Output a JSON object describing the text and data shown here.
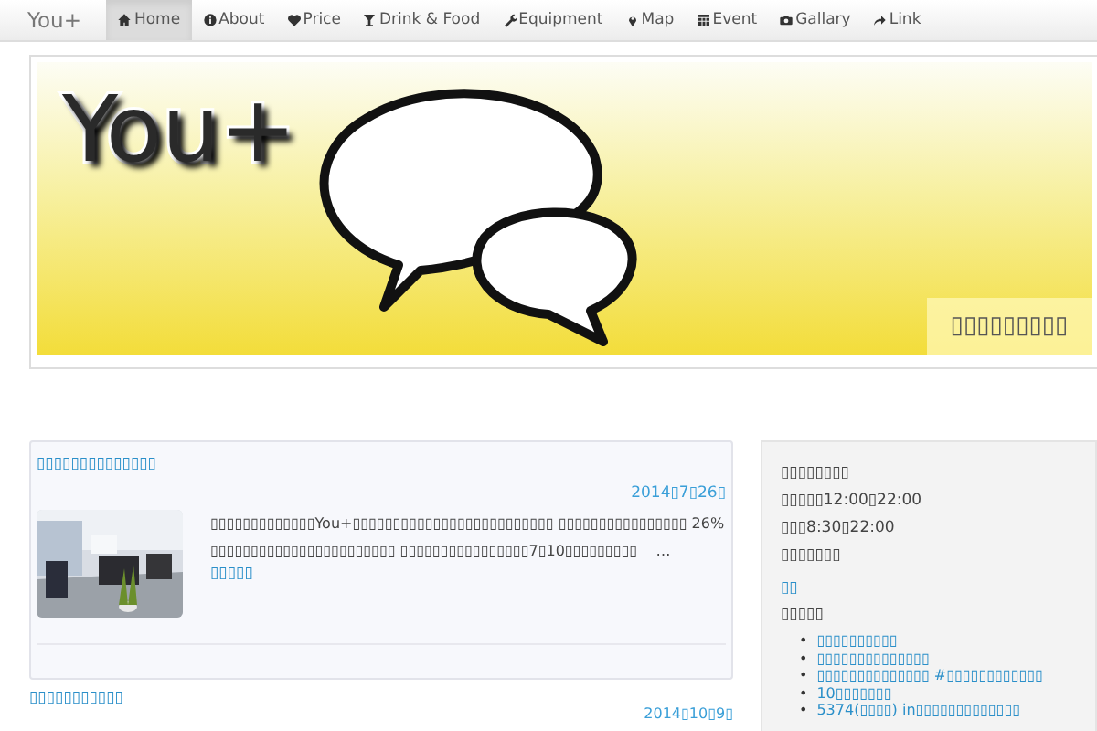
{
  "navbar": {
    "brand": "You+",
    "items": [
      {
        "label": "Home",
        "selected": true
      },
      {
        "label": "About",
        "selected": false
      },
      {
        "label": "Price",
        "selected": false
      },
      {
        "label": "Drink & Food",
        "selected": false
      },
      {
        "label": "Equipment",
        "selected": false
      },
      {
        "label": "Map",
        "selected": false
      },
      {
        "label": "Event",
        "selected": false
      },
      {
        "label": "Gallary",
        "selected": false
      },
      {
        "label": "Link",
        "selected": false
      }
    ]
  },
  "banner": {
    "title": "You+",
    "caption": "▯▯▯▯▯▯▯▯▯"
  },
  "posts": [
    {
      "title": "▯▯▯▯▯▯▯▯▯▯▯▯▯▯",
      "date": "2014▯7▯26▯",
      "kind": "full",
      "excerpt": "▯▯▯▯▯▯▯▯▯▯▯▯▯You+▯▯▯▯▯▯▯▯▯▯▯▯▯▯▯▯▯▯▯▯▯▯▯▯▯ ▯▯▯▯▯▯▯▯▯▯▯▯▯▯▯▯ 26%▯▯▯▯▯▯▯▯▯▯▯▯▯▯▯▯▯▯▯▯▯▯▯ ▯▯▯▯▯▯▯▯▯▯▯▯▯▯▯▯7▯10▯▯▯▯▯▯▯▯▯",
      "ellipsis": "…",
      "more": "▯▯▯▯▯"
    },
    {
      "title": "▯▯▯▯▯▯▯▯▯▯▯",
      "date": "2014▯10▯9▯",
      "kind": "plain"
    }
  ],
  "sidebar": {
    "lines": [
      "▯▯▯▯▯▯▯▯",
      "▯▯▯▯▯12:00▯22:00",
      "▯▯▯8:30▯22:00",
      "▯▯▯▯▯▯▯"
    ],
    "link": "▯▯",
    "heading": "▯▯▯▯▯",
    "list": [
      {
        "bullet": "•",
        "text": "▯▯▯▯▯▯▯▯▯▯"
      },
      {
        "bullet": "•",
        "text": "▯▯▯▯▯▯▯▯▯▯▯▯▯▯"
      },
      {
        "bullet": "•",
        "text": "▯▯▯▯▯▯▯▯▯▯▯▯▯▯ #▯▯▯▯▯▯▯▯▯▯▯▯"
      },
      {
        "bullet": "•",
        "text": "10▯▯▯▯▯▯▯"
      },
      {
        "bullet": "•",
        "text": "5374(▯▯▯▯) in▯▯▯▯▯▯▯▯▯▯▯▯▯"
      }
    ]
  }
}
